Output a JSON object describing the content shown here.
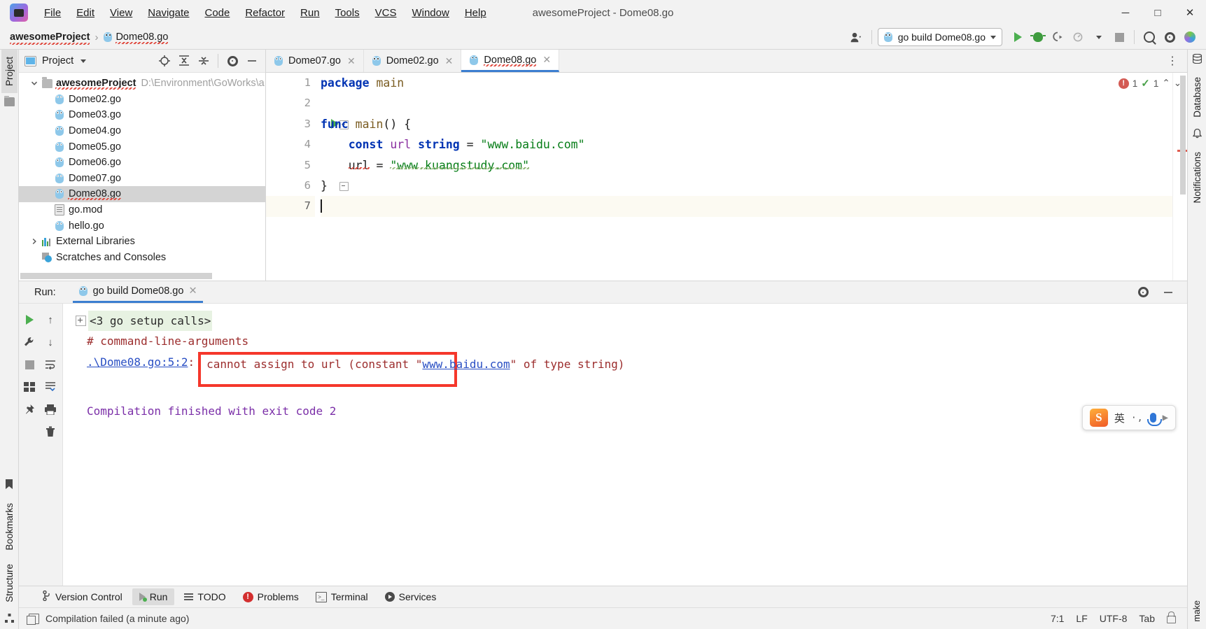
{
  "window": {
    "title": "awesomeProject - Dome08.go",
    "minimize": "─",
    "maximize": "□",
    "close": "✕"
  },
  "menu": {
    "items": [
      {
        "label": "File",
        "accel": "F"
      },
      {
        "label": "Edit",
        "accel": "E"
      },
      {
        "label": "View",
        "accel": "V"
      },
      {
        "label": "Navigate",
        "accel": "N"
      },
      {
        "label": "Code",
        "accel": "C"
      },
      {
        "label": "Refactor",
        "accel": "R"
      },
      {
        "label": "Run",
        "accel": "R"
      },
      {
        "label": "Tools",
        "accel": "T"
      },
      {
        "label": "VCS",
        "accel": "S"
      },
      {
        "label": "Window",
        "accel": "W"
      },
      {
        "label": "Help",
        "accel": "H"
      }
    ]
  },
  "navbar": {
    "breadcrumb_project": "awesomeProject",
    "breadcrumb_separator": "›",
    "breadcrumb_file": "Dome08.go",
    "run_config": "go build Dome08.go",
    "run_config_caret": "▾",
    "profile_caret": "▾",
    "more_caret": "▾"
  },
  "rails": {
    "left_top": "Project",
    "left_bottom_1": "Bookmarks",
    "left_bottom_2": "Structure",
    "right_1": "Database",
    "right_2": "Notifications",
    "right_3": "make"
  },
  "project_panel": {
    "title": "Project",
    "title_caret": "▾",
    "tree": [
      {
        "depth": 0,
        "label": "awesomeProject",
        "path": "D:\\Environment\\GoWorks\\a",
        "icon": "folder-icon",
        "bold": true,
        "arrow": "down",
        "selected": false,
        "squiggle": true
      },
      {
        "depth": 1,
        "label": "Dome02.go",
        "path": "",
        "icon": "go-file-icon",
        "bold": false,
        "arrow": "",
        "selected": false,
        "squiggle": false
      },
      {
        "depth": 1,
        "label": "Dome03.go",
        "path": "",
        "icon": "go-file-icon",
        "bold": false,
        "arrow": "",
        "selected": false,
        "squiggle": false
      },
      {
        "depth": 1,
        "label": "Dome04.go",
        "path": "",
        "icon": "go-file-icon",
        "bold": false,
        "arrow": "",
        "selected": false,
        "squiggle": false
      },
      {
        "depth": 1,
        "label": "Dome05.go",
        "path": "",
        "icon": "go-file-icon",
        "bold": false,
        "arrow": "",
        "selected": false,
        "squiggle": false
      },
      {
        "depth": 1,
        "label": "Dome06.go",
        "path": "",
        "icon": "go-file-icon",
        "bold": false,
        "arrow": "",
        "selected": false,
        "squiggle": false
      },
      {
        "depth": 1,
        "label": "Dome07.go",
        "path": "",
        "icon": "go-file-icon",
        "bold": false,
        "arrow": "",
        "selected": false,
        "squiggle": false
      },
      {
        "depth": 1,
        "label": "Dome08.go",
        "path": "",
        "icon": "go-file-icon",
        "bold": false,
        "arrow": "",
        "selected": true,
        "squiggle": true
      },
      {
        "depth": 1,
        "label": "go.mod",
        "path": "",
        "icon": "document-icon",
        "bold": false,
        "arrow": "",
        "selected": false,
        "squiggle": false
      },
      {
        "depth": 1,
        "label": "hello.go",
        "path": "",
        "icon": "go-file-icon",
        "bold": false,
        "arrow": "",
        "selected": false,
        "squiggle": false
      },
      {
        "depth": 0,
        "label": "External Libraries",
        "path": "",
        "icon": "library-icon",
        "bold": false,
        "arrow": "right",
        "selected": false,
        "squiggle": false
      },
      {
        "depth": 0,
        "label": "Scratches and Consoles",
        "path": "",
        "icon": "scratches-icon",
        "bold": false,
        "arrow": "",
        "selected": false,
        "squiggle": false
      }
    ]
  },
  "editor": {
    "tabs": [
      {
        "label": "Dome07.go",
        "active": false
      },
      {
        "label": "Dome02.go",
        "active": false
      },
      {
        "label": "Dome08.go",
        "active": true
      }
    ],
    "tab_close": "✕",
    "overflow": "⋮",
    "line_numbers": [
      "1",
      "2",
      "3",
      "4",
      "5",
      "6",
      "7"
    ],
    "lines": [
      {
        "n": 1,
        "tokens": [
          {
            "t": "package ",
            "c": "k"
          },
          {
            "t": "main",
            "c": "fn"
          }
        ]
      },
      {
        "n": 2,
        "tokens": []
      },
      {
        "n": 3,
        "tokens": [
          {
            "t": "func ",
            "c": "k"
          },
          {
            "t": "main",
            "c": "fn"
          },
          {
            "t": "() {",
            "c": "pl"
          }
        ]
      },
      {
        "n": 4,
        "tokens": [
          {
            "t": "    const ",
            "c": "k"
          },
          {
            "t": "url ",
            "c": "ty"
          },
          {
            "t": "string",
            "c": "k"
          },
          {
            "t": " = ",
            "c": "pl"
          },
          {
            "t": "\"www.baidu.com\"",
            "c": "st"
          }
        ]
      },
      {
        "n": 5,
        "tokens": [
          {
            "t": "    ",
            "c": "pl"
          },
          {
            "t": "url",
            "c": "pl"
          },
          {
            "t": " = ",
            "c": "pl"
          },
          {
            "t": "\"www.kuangstudy.com\"",
            "c": "st"
          }
        ]
      },
      {
        "n": 6,
        "tokens": [
          {
            "t": "}",
            "c": "pl"
          }
        ]
      },
      {
        "n": 7,
        "tokens": []
      }
    ],
    "raw_text": "package main\n\nfunc main() {\n    const url string = \"www.baidu.com\"\n    url = \"www.kuangstudy.com\"\n}\n",
    "error_count": "1",
    "warning_count": "1",
    "collapse_caret": "⌃",
    "expand_caret": "⌄"
  },
  "run_panel": {
    "label": "Run:",
    "tab": "go build Dome08.go",
    "tab_close": "✕",
    "settings_icon": "gear-icon",
    "minimize_icon": "minimize-icon",
    "console": {
      "setup_calls": "<3 go setup calls>",
      "command_line": "# command-line-arguments",
      "error_location": ".\\Dome08.go:5:2",
      "error_colon": ":",
      "error_message_pre": "cannot assign to url (constant \"",
      "error_message_link": "www.baidu.com",
      "error_message_post": "\" of type string)",
      "finished": "Compilation finished with exit code 2"
    }
  },
  "ime": {
    "logo": "S",
    "lang": "英",
    "dots": "·,",
    "mic": "mic-icon"
  },
  "bottom_tabs": [
    {
      "label": "Version Control",
      "icon": "branch-icon",
      "selected": false
    },
    {
      "label": "Run",
      "icon": "run-icon",
      "selected": true
    },
    {
      "label": "TODO",
      "icon": "todo-icon",
      "selected": false
    },
    {
      "label": "Problems",
      "icon": "problems-icon",
      "selected": false
    },
    {
      "label": "Terminal",
      "icon": "terminal-icon",
      "selected": false
    },
    {
      "label": "Services",
      "icon": "services-icon",
      "selected": false
    }
  ],
  "status_bar": {
    "message": "Compilation failed (a minute ago)",
    "caret_position": "7:1",
    "line_separator": "LF",
    "encoding": "UTF-8",
    "indent": "Tab",
    "lock": "lock-icon"
  },
  "colors": {
    "accent_blue": "#3c7ed0",
    "error_red": "#f5372b",
    "keyword_blue": "#0033b3",
    "string_green": "#067d17",
    "type_purple": "#8a2fa0",
    "console_red": "#9c2d2d",
    "link_blue": "#2a4fc4",
    "finished_purple": "#7b2fa8",
    "selection_gray": "#d4d4d4"
  }
}
